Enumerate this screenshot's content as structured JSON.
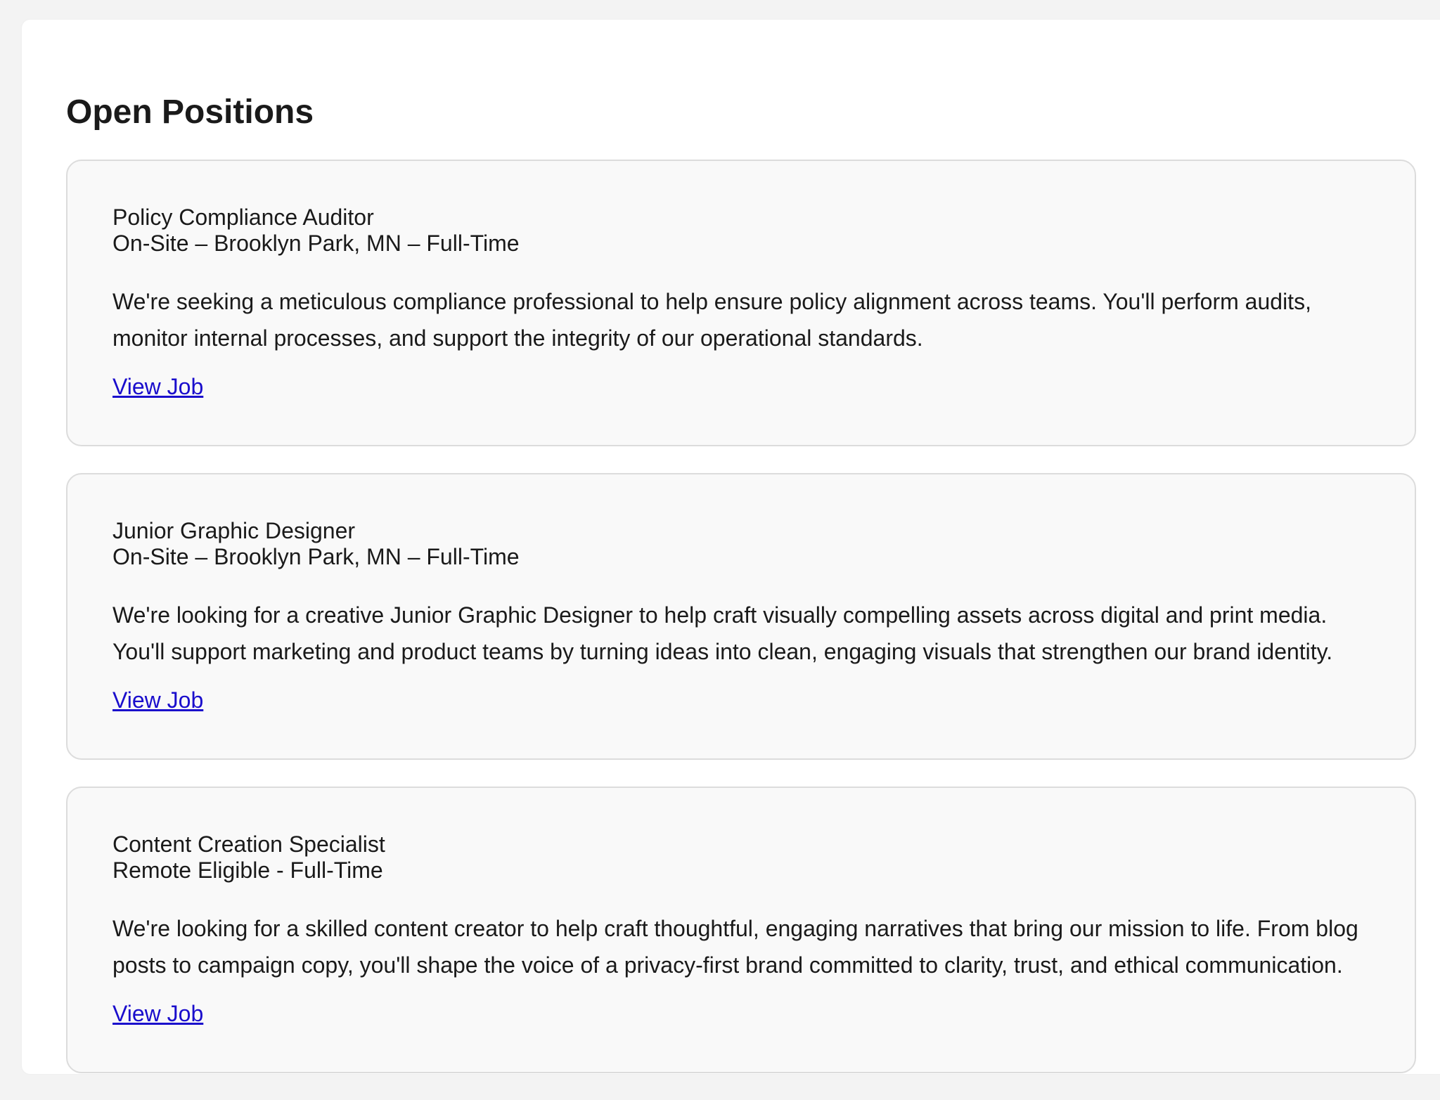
{
  "page": {
    "title": "Open Positions"
  },
  "jobs": [
    {
      "title": "Policy Compliance Auditor",
      "meta": "On-Site – Brooklyn Park, MN – Full-Time",
      "description": "We're seeking a meticulous compliance professional to help ensure policy alignment across teams. You'll perform audits, monitor internal processes, and support the integrity of our operational standards.",
      "link_label": "View Job"
    },
    {
      "title": "Junior Graphic Designer",
      "meta": "On-Site – Brooklyn Park, MN – Full-Time",
      "description": "We're looking for a creative Junior Graphic Designer to help craft visually compelling assets across digital and print media. You'll support marketing and product teams by turning ideas into clean, engaging visuals that strengthen our brand identity.",
      "link_label": "View Job"
    },
    {
      "title": "Content Creation Specialist",
      "meta": "Remote Eligible - Full-Time",
      "description": "We're looking for a skilled content creator to help craft thoughtful, engaging narratives that bring our mission to life. From blog posts to campaign copy, you'll shape the voice of a privacy-first brand committed to clarity, trust, and ethical communication.",
      "link_label": "View Job"
    }
  ],
  "colors": {
    "page_background": "#f3f3f3",
    "panel_background": "#ffffff",
    "card_background": "#f9f9f9",
    "card_border": "#dcdcdc",
    "link": "#1a0dcc"
  }
}
